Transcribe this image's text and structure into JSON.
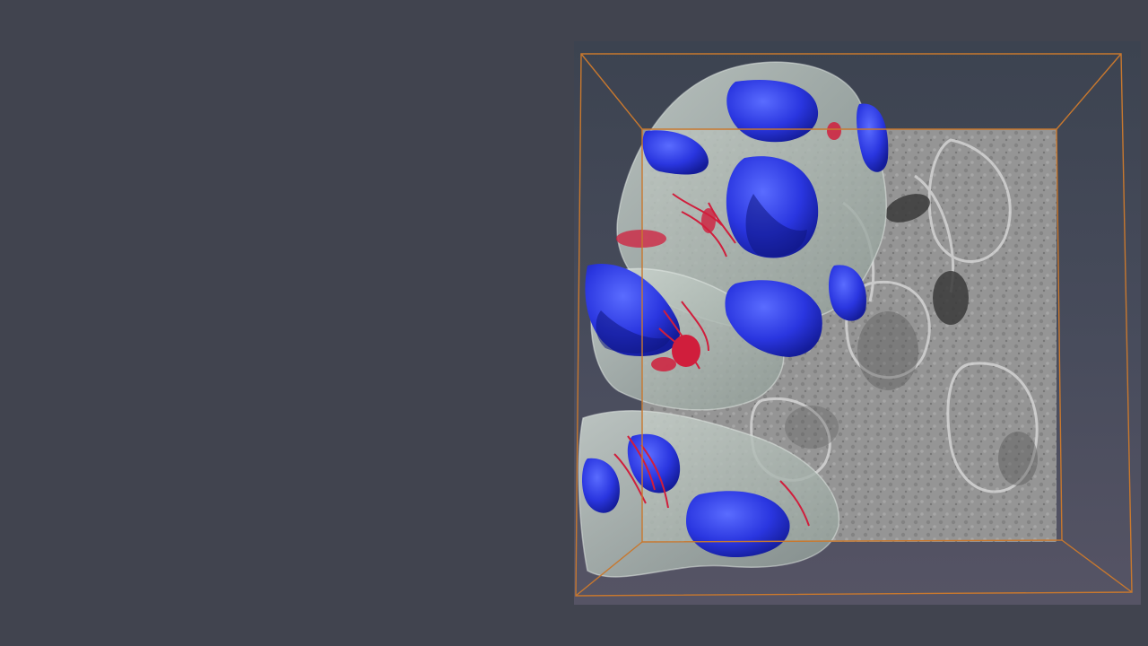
{
  "viewer": {
    "background_color": "#41444f",
    "render_panel": "3d-volume-render",
    "colors": {
      "bounding_box": "#c8782e",
      "em_slice_tint": "#9a9a9a",
      "cell_membrane": "#b8c4bc",
      "nuclei": "#2a36e0",
      "mitochondria_network": "#d01e3c"
    },
    "layers": [
      "em-slice",
      "cell-membrane-mesh",
      "nucleus-mesh",
      "mitochondria-mesh",
      "bounding-box"
    ]
  }
}
